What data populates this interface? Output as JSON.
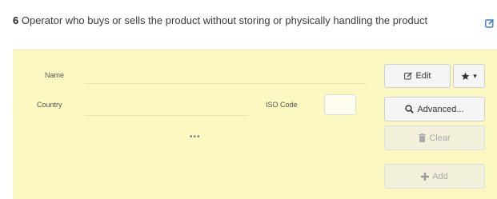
{
  "section": {
    "number": "6",
    "title": "Operator who buys or sells the product without storing or physically handling the product"
  },
  "form": {
    "name_label": "Name",
    "country_label": "Country",
    "iso_label": "ISO Code",
    "ellipsis": "•••"
  },
  "buttons": {
    "edit": "Edit",
    "favorites_caret": "▾",
    "advanced": "Advanced...",
    "clear": "Clear",
    "add": "Add"
  },
  "icons": [
    "edit-section-icon",
    "pencil-icon",
    "star-icon",
    "search-icon",
    "trash-icon",
    "plus-icon"
  ]
}
